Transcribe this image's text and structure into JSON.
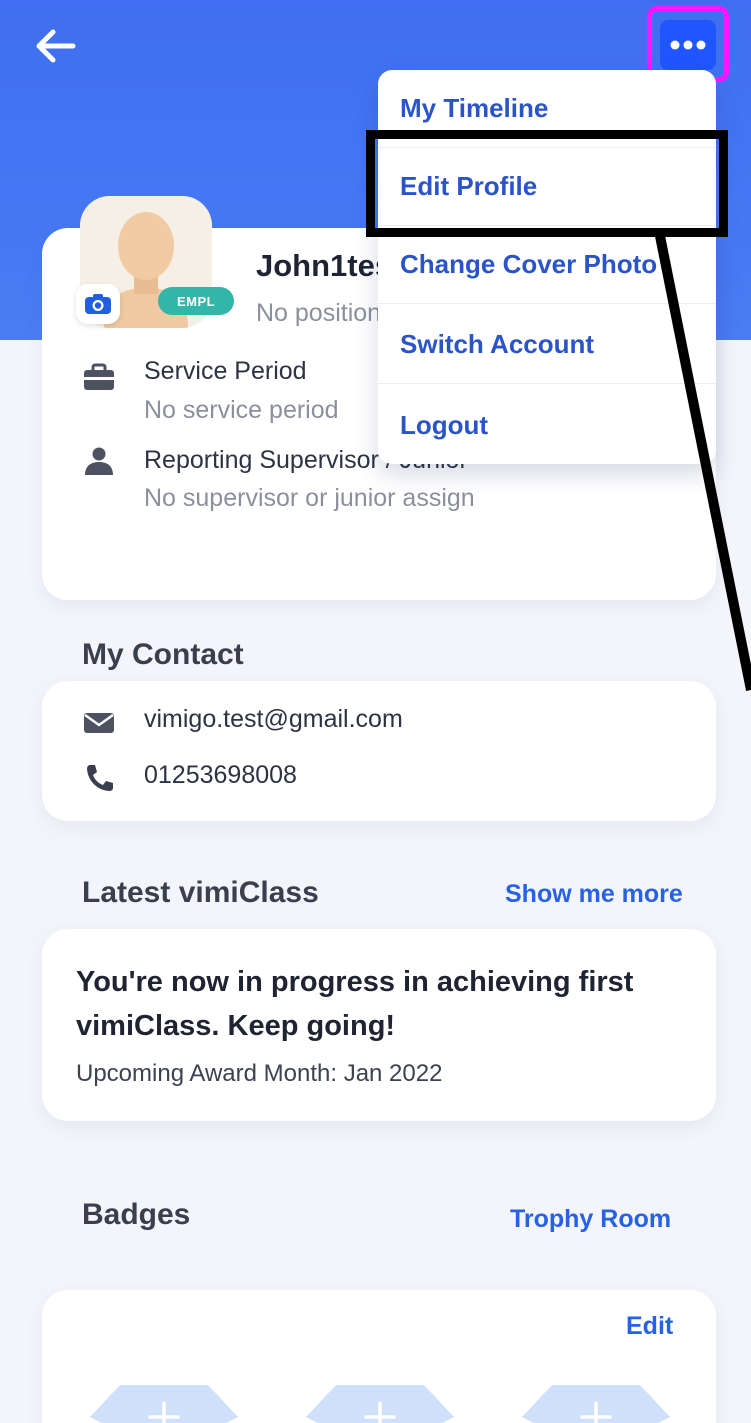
{
  "header": {
    "back_icon": "arrow-left-icon",
    "more_icon": "more-horizontal-icon",
    "accent_color": "#3f6ff0",
    "more_button_color": "#2056ff",
    "highlight_color": "#ff14ff"
  },
  "menu": {
    "items": [
      {
        "label": "My Timeline"
      },
      {
        "label": "Edit Profile"
      },
      {
        "label": "Change Cover Photo"
      },
      {
        "label": "Switch Account"
      },
      {
        "label": "Logout"
      }
    ]
  },
  "profile": {
    "name": "John1test",
    "position": "No position",
    "badge": "EMPL",
    "camera_icon": "camera-icon",
    "service_period_title": "Service Period",
    "service_period_value": "No service period",
    "supervisor_title": "Reporting Supervisor / Junior",
    "supervisor_value": "No supervisor or junior assign"
  },
  "contact": {
    "title": "My Contact",
    "email": "vimigo.test@gmail.com",
    "phone": "01253698008"
  },
  "vimiclass": {
    "title": "Latest vimiClass",
    "link": "Show me more",
    "message": "You're now in progress in achieving first vimiClass. Keep going!",
    "award": "Upcoming Award Month: Jan 2022"
  },
  "badges": {
    "title": "Badges",
    "link": "Trophy Room",
    "edit": "Edit",
    "slot_icon": "plus-icon",
    "slot_color": "#cfe0fb"
  }
}
